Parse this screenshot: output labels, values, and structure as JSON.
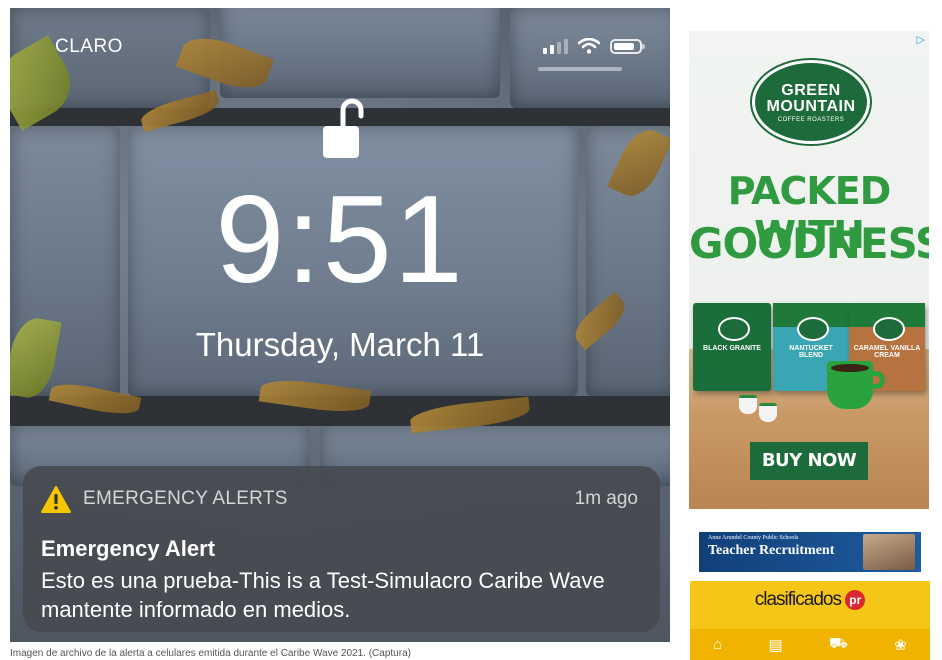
{
  "lockscreen": {
    "carrier": "CLARO",
    "time": "9:51",
    "date": "Thursday, March 11",
    "notification": {
      "app": "EMERGENCY ALERTS",
      "age": "1m ago",
      "title": "Emergency Alert",
      "body": "Esto es una prueba-This is a Test-Simulacro Caribe Wave mantente informado en medios."
    }
  },
  "caption": "Imagen de archivo de la alerta a celulares emitida durante el Caribe Wave 2021. (Captura)",
  "ad_green_mountain": {
    "logo_line1": "GREEN",
    "logo_line2": "MOUNTAIN",
    "logo_line3": "COFFEE ROASTERS",
    "headline_1": "PACKED WITH",
    "headline_2": "GOODNESS",
    "products": [
      "BLACK GRANITE",
      "NANTUCKET BLEND",
      "CARAMEL VANILLA CREAM"
    ],
    "cta": "BUY NOW",
    "brand_color": "#1d6b3a",
    "accent_color": "#2f9a3f"
  },
  "ad_teacher": {
    "org": "Anne Arundel County Public Schools",
    "title": "Teacher Recruitment",
    "site": "clasificados",
    "site_badge": "pr",
    "accent_color": "#f5c518"
  },
  "icons": [
    "lock-open-icon",
    "signal-icon",
    "wifi-icon",
    "battery-icon",
    "warning-icon",
    "adchoices-icon",
    "home-icon",
    "inbox-icon",
    "car-icon",
    "pet-icon"
  ]
}
